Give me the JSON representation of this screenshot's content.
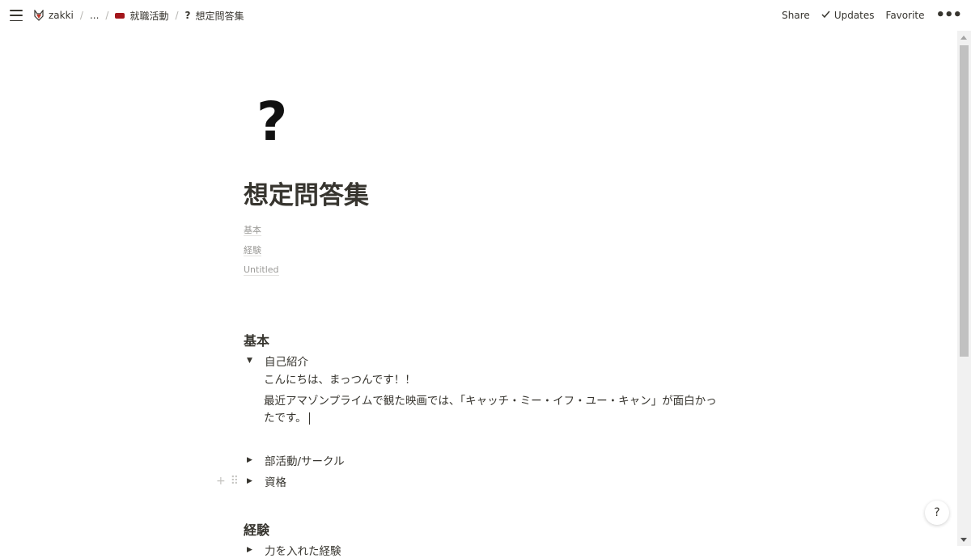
{
  "topbar": {
    "breadcrumb": [
      {
        "label": "zakki",
        "icon": "fox-icon"
      },
      {
        "label": "..."
      },
      {
        "label": "就職活動",
        "icon": "folder-icon"
      },
      {
        "label": "想定問答集",
        "icon": "question-mark-icon",
        "icon_text": "?"
      }
    ],
    "share": "Share",
    "updates": "Updates",
    "favorite": "Favorite",
    "more": "•••"
  },
  "page": {
    "icon": "?",
    "title": "想定問答集",
    "toc": [
      "基本",
      "経験",
      "Untitled"
    ],
    "sections": [
      {
        "heading": "基本",
        "toggles": [
          {
            "label": "自己紹介",
            "open": true,
            "body": [
              "こんにちは、まっつんです！！",
              "最近アマゾンプライムで観た映画では、「キャッチ・ミー・イフ・ユー・キャン」が面白かったです。"
            ]
          },
          {
            "label": "部活動/サークル",
            "open": false
          },
          {
            "label": "資格",
            "open": false
          }
        ]
      },
      {
        "heading": "経験",
        "toggles": [
          {
            "label": "力を入れた経験",
            "open": false
          }
        ]
      }
    ]
  },
  "help": "?"
}
